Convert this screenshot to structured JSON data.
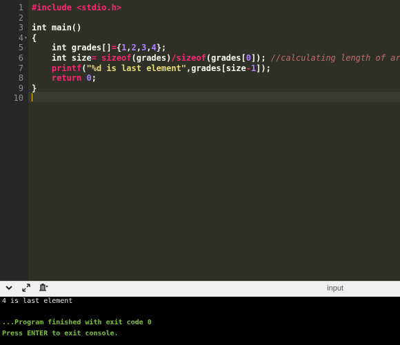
{
  "editor": {
    "line_numbers": [
      "1",
      "2",
      "3",
      "4",
      "5",
      "6",
      "7",
      "8",
      "9",
      "10"
    ],
    "lines": {
      "l1_pp": "#include ",
      "l1_hdr": "<stdio.h>",
      "l3": "int main()",
      "l4": "{",
      "l5_a": "    int grades[]",
      "l5_b": "=",
      "l5_c": "{",
      "l5_nums": [
        "1",
        ",",
        "2",
        ",",
        "3",
        ",",
        "4"
      ],
      "l5_d": "};",
      "l6_a": "    int size",
      "l6_b": "= ",
      "l6_c": "sizeof",
      "l6_d": "(grades)",
      "l6_e": "/",
      "l6_f": "sizeof",
      "l6_g": "(grades[",
      "l6_h": "0",
      "l6_i": "]); ",
      "l6_comment": "//calculating length of array",
      "l7_a": "    ",
      "l7_fn": "printf",
      "l7_b": "(",
      "l7_str": "\"%d is last element\"",
      "l7_c": ",grades[size",
      "l7_d": "-",
      "l7_e": "1",
      "l7_f": "]);",
      "l8_a": "    ",
      "l8_kw": "return",
      "l8_b": " ",
      "l8_num": "0",
      "l8_c": ";",
      "l9": "}"
    }
  },
  "toolbar": {
    "collapse_icon": "chevron-down-icon",
    "expand_icon": "expand-arrows-icon",
    "clear_icon": "clear-console-icon",
    "input_label": "input"
  },
  "console": {
    "output_line": "4 is last element",
    "finished_line": "...Program finished with exit code 0",
    "press_line": "Press ENTER to exit console."
  },
  "colors": {
    "editor_bg": "#2f3129",
    "gutter_bg": "#262626",
    "console_bg": "#000000",
    "console_green": "#7ec13e"
  }
}
